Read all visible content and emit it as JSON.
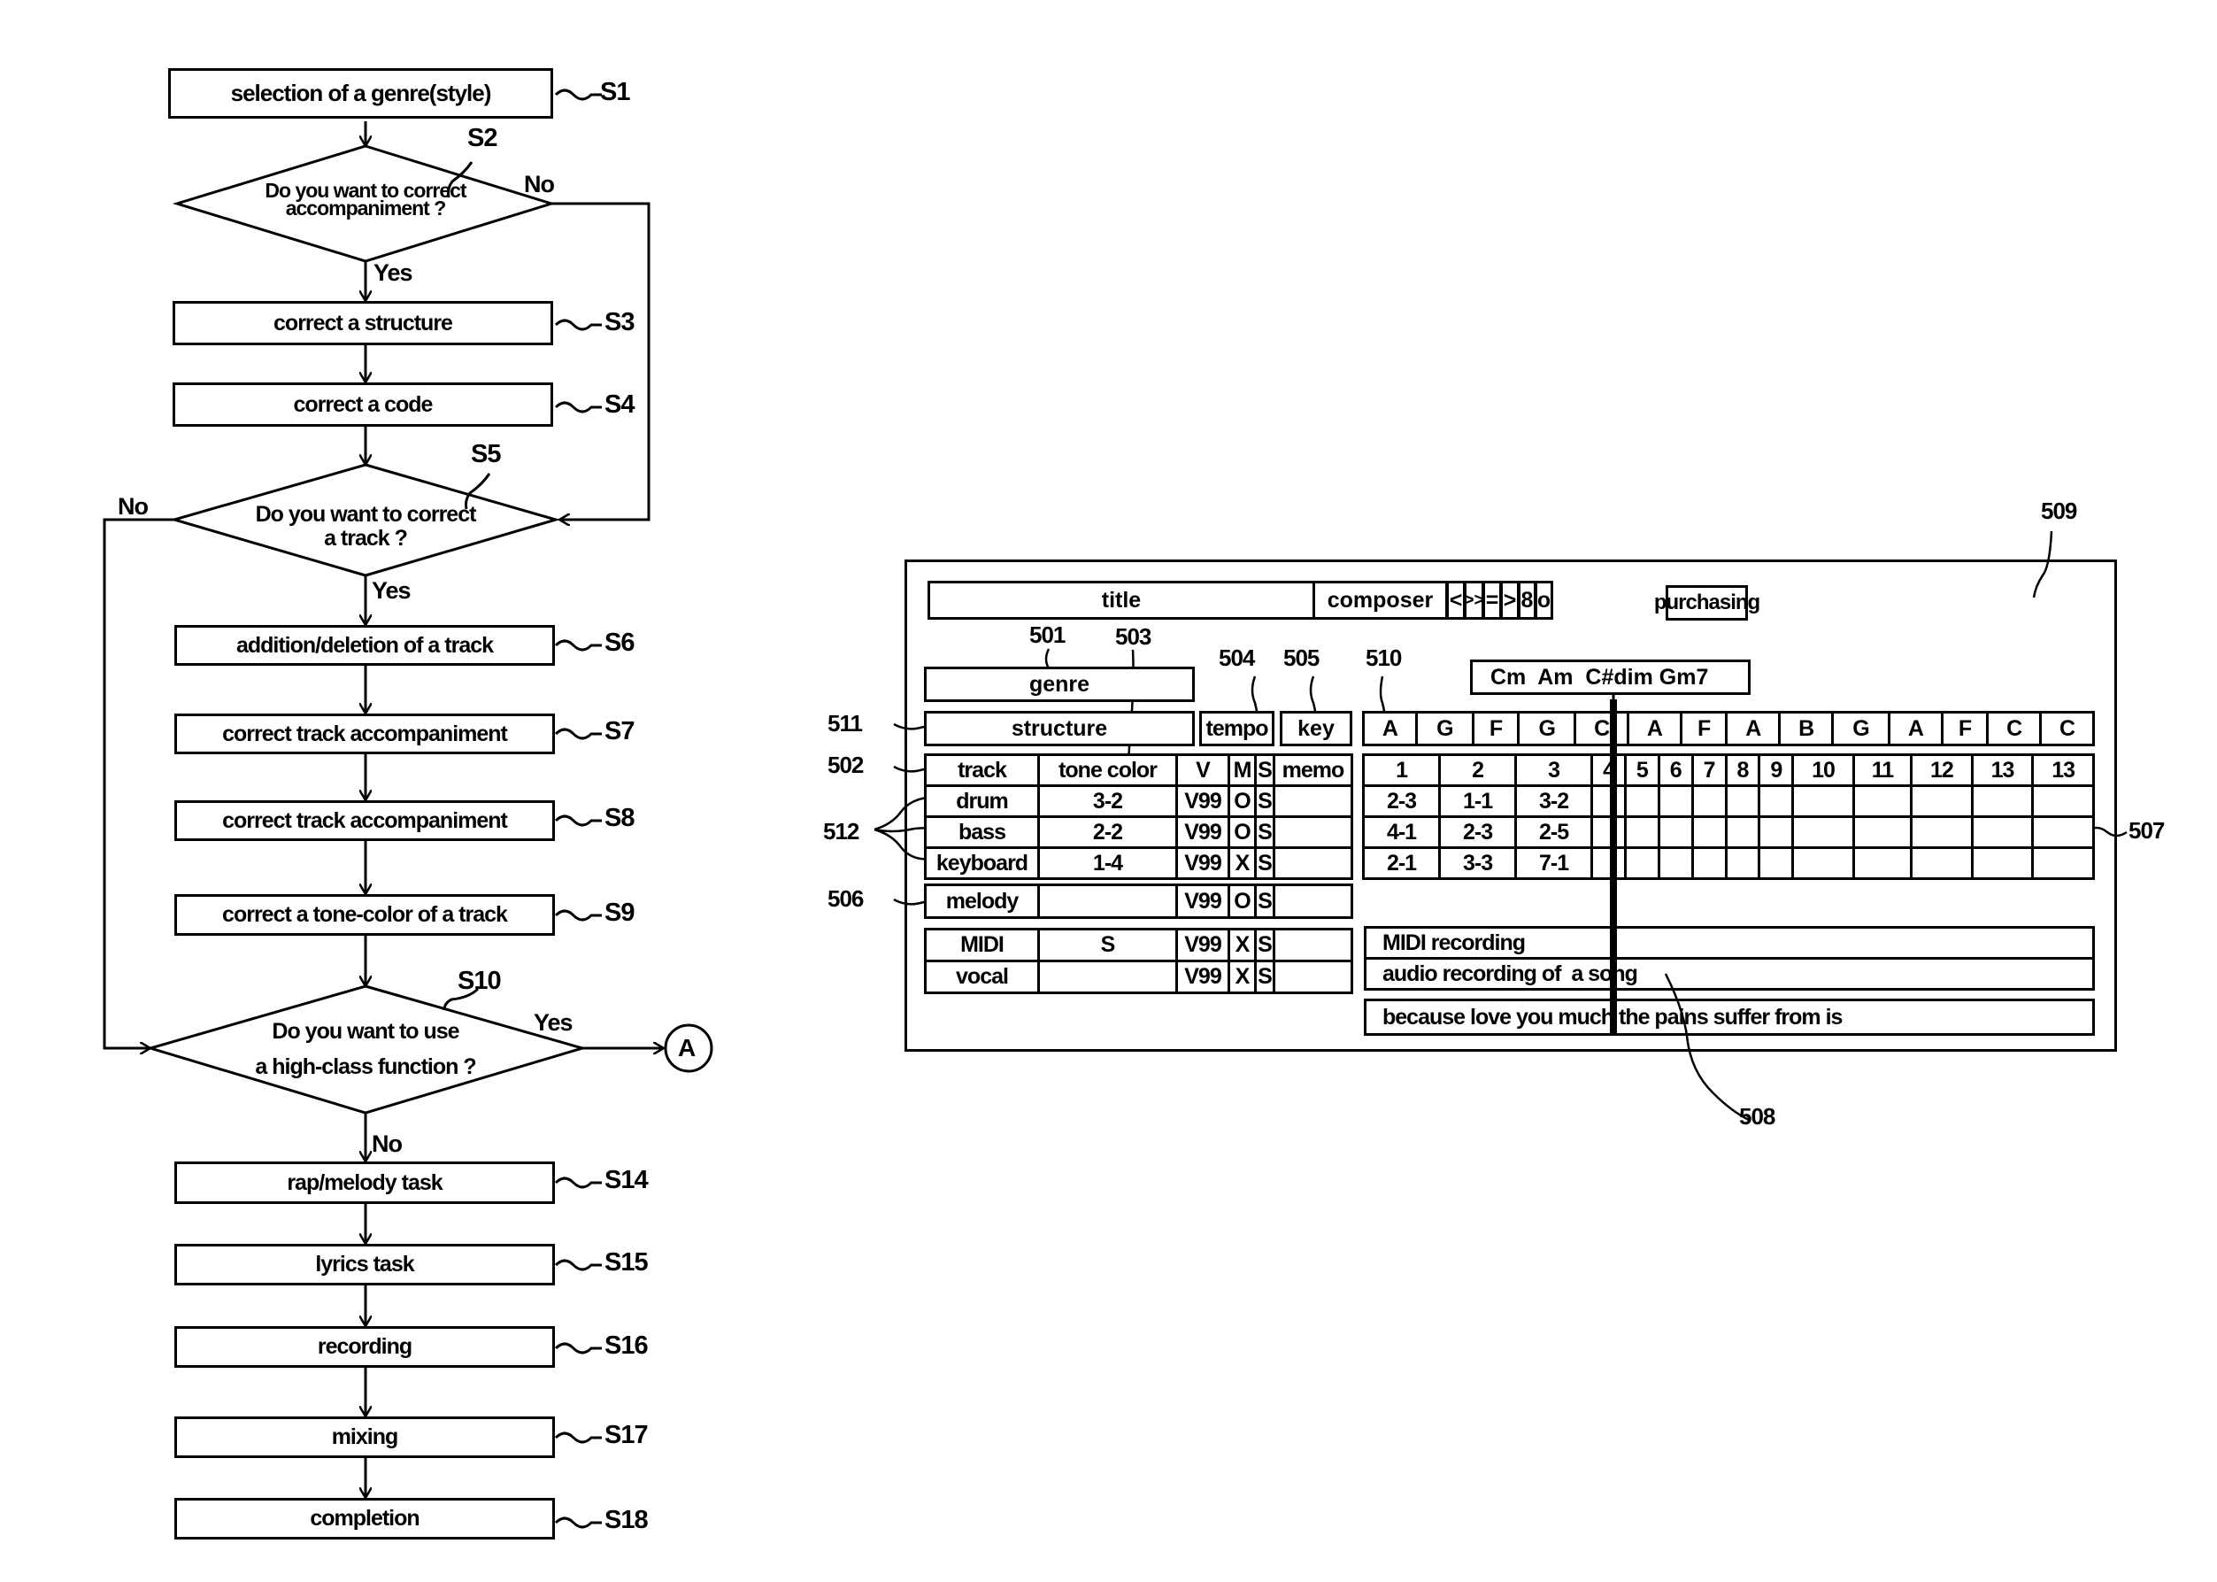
{
  "flowchart": {
    "steps": [
      {
        "id": "S1",
        "text": "selection of a genre(style)"
      },
      {
        "id": "S3",
        "text": "correct a structure"
      },
      {
        "id": "S4",
        "text": "correct a code"
      },
      {
        "id": "S6",
        "text": "addition/deletion of a track"
      },
      {
        "id": "S7",
        "text": "correct track accompaniment"
      },
      {
        "id": "S8",
        "text": "correct track accompaniment"
      },
      {
        "id": "S9",
        "text": "correct a tone-color of a track"
      },
      {
        "id": "S14",
        "text": "rap/melody task"
      },
      {
        "id": "S15",
        "text": "lyrics task"
      },
      {
        "id": "S16",
        "text": "recording"
      },
      {
        "id": "S17",
        "text": "mixing"
      },
      {
        "id": "S18",
        "text": "completion"
      }
    ],
    "decisions": [
      {
        "id": "S2",
        "line1": "Do you want to correct",
        "line2": "accompaniment ?",
        "yes": "Yes",
        "no": "No"
      },
      {
        "id": "S5",
        "line1": "Do you want to correct",
        "line2": "a track ?",
        "yes": "Yes",
        "no": "No"
      },
      {
        "id": "S10",
        "line1": "Do you want to use",
        "line2": "a high-class function ?",
        "yes": "Yes",
        "no": "No"
      }
    ],
    "connector": "A"
  },
  "ui": {
    "title": "title",
    "composer": "composer",
    "transport": [
      "<",
      ">>",
      "=",
      ">",
      "8",
      "o"
    ],
    "purchasing": "purchasing",
    "genre": "genre",
    "structure": "structure",
    "tempo": "tempo",
    "key": "key",
    "chords": "Cm  Am  C#dim Gm7",
    "section_letters": [
      "A",
      "G",
      "F",
      "G",
      "C",
      "A",
      "F",
      "A",
      "B",
      "G",
      "A",
      "F",
      "C",
      "C"
    ],
    "measures": [
      "1",
      "2",
      "3",
      "4",
      "5",
      "6",
      "7",
      "8",
      "9",
      "10",
      "11",
      "12",
      "13",
      "13"
    ],
    "track_header": {
      "track": "track",
      "tone_color": "tone color",
      "v": "V",
      "m": "M",
      "s": "S",
      "memo": "memo"
    },
    "tracks": [
      {
        "name": "drum",
        "tone": "3-2",
        "v": "V99",
        "m": "O",
        "s": "S",
        "memo": "",
        "cells": [
          "2-3",
          "1-1",
          "3-2"
        ]
      },
      {
        "name": "bass",
        "tone": "2-2",
        "v": "V99",
        "m": "O",
        "s": "S",
        "memo": "",
        "cells": [
          "4-1",
          "2-3",
          "2-5"
        ]
      },
      {
        "name": "keyboard",
        "tone": "1-4",
        "v": "V99",
        "m": "X",
        "s": "S",
        "memo": "",
        "cells": [
          "2-1",
          "3-3",
          "7-1"
        ]
      }
    ],
    "melody": {
      "name": "melody",
      "tone": "",
      "v": "V99",
      "m": "O",
      "s": "S",
      "memo": ""
    },
    "extra_tracks": [
      {
        "name": "MIDI",
        "tone": "S",
        "v": "V99",
        "m": "X",
        "s": "S",
        "memo": ""
      },
      {
        "name": "vocal",
        "tone": "",
        "v": "V99",
        "m": "X",
        "s": "S",
        "memo": ""
      }
    ],
    "midi_recording": "MIDI recording",
    "audio_recording": "audio recording of  a song",
    "lyrics": "because love you much the pains suffer from is"
  },
  "refs": {
    "r501": "501",
    "r502": "502",
    "r503": "503",
    "r504": "504",
    "r505": "505",
    "r506": "506",
    "r507": "507",
    "r508": "508",
    "r509": "509",
    "r510": "510",
    "r511": "511",
    "r512": "512"
  }
}
